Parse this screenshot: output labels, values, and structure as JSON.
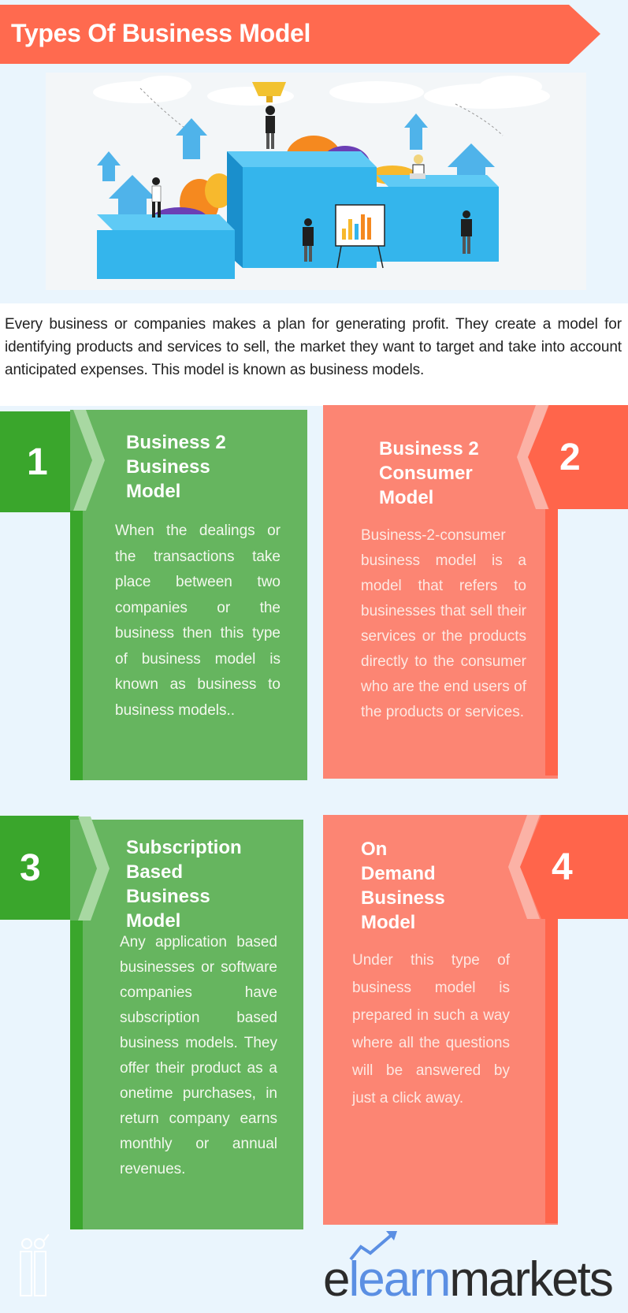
{
  "header": {
    "title": "Types Of Business Model"
  },
  "hero": {
    "description": "Illustration of business people on blue podium blocks with trophy, arrows and chart board"
  },
  "intro": {
    "text": "Every business or companies makes a plan for generating profit. They create a model for identifying products and services to sell, the market they want to target and take into account anticipated expenses. This model is known as business models."
  },
  "models": [
    {
      "number": "1",
      "title": "Business  2\nBusiness\nModel",
      "body": "When the dealings or the transactions take place between two companies or the business then this type of business model is known as business to business models..",
      "color": "#66b55f",
      "accent": "#3aa62c"
    },
    {
      "number": "2",
      "title": "Business  2\nConsumer\nModel",
      "body": "Business-2-consumer business model is a model that refers to businesses that sell their services or the products directly to the consumer who are the end users of the products or services.",
      "color": "#fc8573",
      "accent": "#ff654b"
    },
    {
      "number": "3",
      "title": "Subscription\nBased\nBusiness\nModel",
      "body": "Any application based businesses or software companies have subscription based business models. They offer their product as a onetime purchases, in return company earns monthly or annual revenues.",
      "color": "#66b55f",
      "accent": "#3aa62c"
    },
    {
      "number": "4",
      "title": "On\nDemand\nBusiness\nModel",
      "body": "Under this type of business model is prepared in such a way where all the questions will be answered by just a click away.",
      "color": "#fc8573",
      "accent": "#ff654b"
    }
  ],
  "footer": {
    "logo_part1": "e",
    "logo_part2": "learn",
    "logo_part3": "markets",
    "logo_icon": "trend-arrow-icon",
    "watermark_icon": "people-icon"
  },
  "colors": {
    "primary_red": "#ff6a4f",
    "green": "#66b55f",
    "dark_green": "#3aa62c",
    "salmon": "#fc8573",
    "background": "#eaf5fd",
    "logo_blue": "#5b8fe3"
  }
}
